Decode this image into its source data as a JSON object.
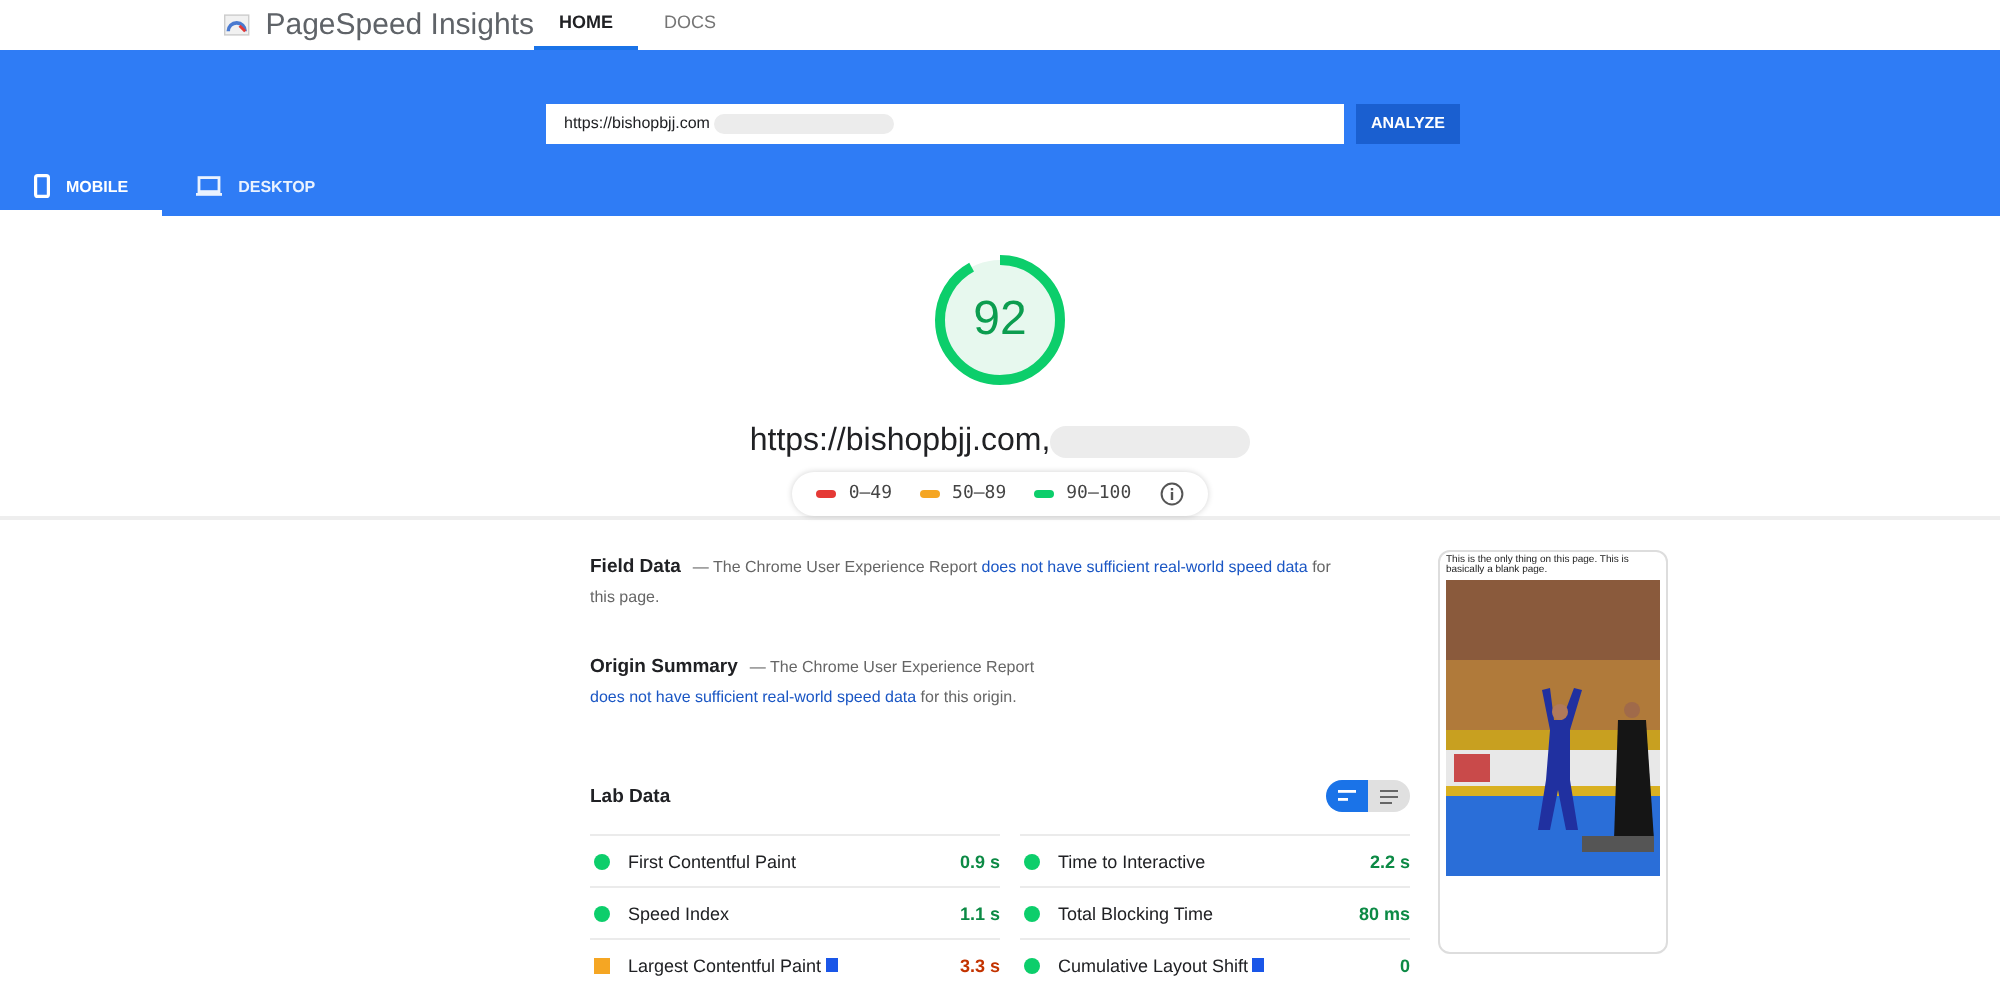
{
  "header": {
    "title": "PageSpeed Insights",
    "nav": [
      {
        "label": "HOME",
        "selected": true
      },
      {
        "label": "DOCS",
        "selected": false
      }
    ]
  },
  "search": {
    "value": "https://bishopbjj.com",
    "button": "ANALYZE"
  },
  "device_tabs": [
    {
      "label": "MOBILE",
      "selected": true,
      "kind": "mobile"
    },
    {
      "label": "DESKTOP",
      "selected": false,
      "kind": "desktop"
    }
  ],
  "score": {
    "value": "92",
    "level": 0.92,
    "url": "https://bishopbjj.com,"
  },
  "legend": [
    {
      "label": "0–49",
      "color": "#e53935"
    },
    {
      "label": "50–89",
      "color": "#f5a623"
    },
    {
      "label": "90–100",
      "color": "#0cce6b"
    }
  ],
  "field_data": {
    "title": "Field Data",
    "text": "— The Chrome User Experience Report ",
    "link": "does not have sufficient real-world speed data",
    "tail": " for this page."
  },
  "origin_summary": {
    "title": "Origin Summary",
    "text": "— The Chrome User Experience Report ",
    "link": "does not have sufficient real-world speed data",
    "tail": " for this origin."
  },
  "lab_data": {
    "title": "Lab Data",
    "view_toggle": [
      {
        "kind": "summary",
        "selected": true
      },
      {
        "kind": "list",
        "selected": false
      }
    ],
    "metrics": [
      {
        "name": "First Contentful Paint",
        "value": "0.9 s",
        "color": "#0cce6b",
        "kind": "pass",
        "flag": false
      },
      {
        "name": "Time to Interactive",
        "value": "2.2 s",
        "color": "#0cce6b",
        "kind": "pass",
        "flag": false
      },
      {
        "name": "Speed Index",
        "value": "1.1 s",
        "color": "#0cce6b",
        "kind": "pass",
        "flag": false
      },
      {
        "name": "Total Blocking Time",
        "value": "80 ms",
        "color": "#0cce6b",
        "kind": "pass",
        "flag": false
      },
      {
        "name": "Largest Contentful Paint",
        "value": "3.3 s",
        "color": "#f5a623",
        "kind": "average",
        "flag": true
      },
      {
        "name": "Cumulative Layout Shift",
        "value": "0",
        "color": "#0cce6b",
        "kind": "pass",
        "flag": true
      }
    ]
  },
  "thumbnail": {
    "caption": "This is the only thing on this page. This is basically a blank page.",
    "kind": "picture"
  }
}
